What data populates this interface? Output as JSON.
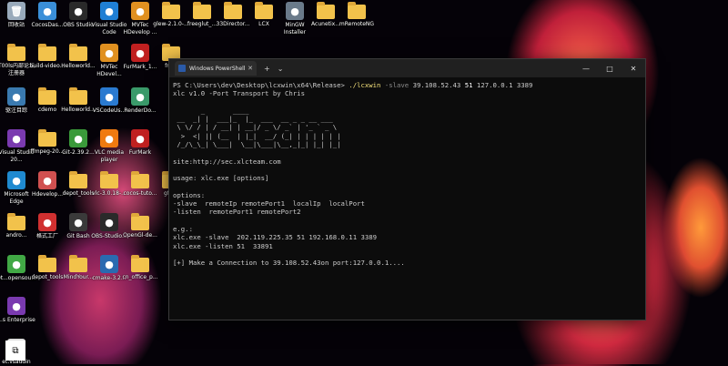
{
  "desktop": {
    "icons": [
      {
        "label": "回收站",
        "type": "recycle",
        "color": "#9ab"
      },
      {
        "label": "CocosDas...",
        "type": "app",
        "color": "#3a8fd8"
      },
      {
        "label": "OBS Studio",
        "type": "app",
        "color": "#2a2a2a"
      },
      {
        "label": "Visual Studio Code",
        "type": "app",
        "color": "#1f7fd4"
      },
      {
        "label": "MVTec HDevelop ...",
        "type": "app",
        "color": "#e09020"
      },
      {
        "label": "glew-2.1.0-...",
        "type": "folder"
      },
      {
        "label": "freeglut_...",
        "type": "folder"
      },
      {
        "label": "33Director...",
        "type": "folder"
      },
      {
        "label": "LCX",
        "type": "folder"
      },
      {
        "label": "MinGW Installer",
        "type": "app",
        "color": "#6a7a8a"
      },
      {
        "label": "Acunetix...",
        "type": "folder"
      },
      {
        "label": "mRemoteNG",
        "type": "folder"
      },
      {
        "label": "T00ls内部论坛注册器",
        "type": "folder"
      },
      {
        "label": "build-video...",
        "type": "folder"
      },
      {
        "label": "Helloworld...",
        "type": "folder"
      },
      {
        "label": "MVTec HDevel...",
        "type": "app",
        "color": "#e09020"
      },
      {
        "label": "FurMark_1...",
        "type": "app",
        "color": "#c02020"
      },
      {
        "label": "fre...",
        "type": "folder"
      },
      {
        "label": "驱注目踪",
        "type": "app",
        "color": "#3a7ab0"
      },
      {
        "label": "cdemo",
        "type": "folder"
      },
      {
        "label": "Helloworld...",
        "type": "folder"
      },
      {
        "label": "VSCodeUs...",
        "type": "app",
        "color": "#2a7ad0"
      },
      {
        "label": "RenderDo...",
        "type": "app",
        "color": "#3a9a6a"
      },
      {
        "label": "Visual Studio 20...",
        "type": "app",
        "color": "#7a3ab0"
      },
      {
        "label": "ffmpeg-20...",
        "type": "folder"
      },
      {
        "label": "Git-2.39.2...",
        "type": "app",
        "color": "#3a9a3a"
      },
      {
        "label": "VLC media player",
        "type": "app",
        "color": "#f07a10"
      },
      {
        "label": "FurMark",
        "type": "app",
        "color": "#c02020"
      },
      {
        "label": "Microsoft Edge",
        "type": "app",
        "color": "#1f8ad0"
      },
      {
        "label": "Hdevelop...",
        "type": "app",
        "color": "#d05050"
      },
      {
        "label": "depot_tools",
        "type": "folder"
      },
      {
        "label": "vlc-3.0.18-...",
        "type": "folder"
      },
      {
        "label": "cocos-tuto...",
        "type": "folder"
      },
      {
        "label": "gfw...",
        "type": "folder"
      },
      {
        "label": "andro...",
        "type": "folder"
      },
      {
        "label": "格式工厂",
        "type": "app",
        "color": "#d03030"
      },
      {
        "label": "Git Bash",
        "type": "app",
        "color": "#3a3a3a"
      },
      {
        "label": "OBS-Studio...",
        "type": "app",
        "color": "#2a2a2a"
      },
      {
        "label": "OpenGl-de...",
        "type": "folder"
      },
      {
        "label": "Qt...opensou...",
        "type": "app",
        "color": "#41a845"
      },
      {
        "label": "depot_tools",
        "type": "folder"
      },
      {
        "label": "MindYour...",
        "type": "folder"
      },
      {
        "label": "cmake-3.2...",
        "type": "app",
        "color": "#2a6ab0"
      },
      {
        "label": "cn_office_p...",
        "type": "folder"
      },
      {
        "label": "...s Enterprise",
        "type": "app",
        "color": "#7a3ab0"
      },
      {
        "label": "et.vsaddin",
        "type": "file"
      }
    ]
  },
  "terminal": {
    "window_title": "Windows PowerShell",
    "new_tab_glyph": "+",
    "dropdown_glyph": "⌄",
    "minimize_glyph": "—",
    "maximize_glyph": "□",
    "close_glyph": "✕",
    "prompt": "PS C:\\Users\\dev\\Desktop\\lcxwin\\x64\\Release> ",
    "command": "./lcxwin",
    "arg_flag": " -slave",
    "arg_ip": " 39.108.52.43 ",
    "arg_port": "51",
    "arg_rest": " 127.0.0.1 3389",
    "lines": [
      "xlc v1.0 -Port Transport by Chris",
      "",
      "       _       ____",
      " __  _| |  ___|_  |_  ___  __ _ _ __ ___",
      " \\ \\/ / | / __| | __|/ _ \\/ _` | '_ ` _ \\",
      "  >  <| || (__  | |_|  __/ (_| | | | | | |",
      " /_/\\_\\_| \\___|  \\__|\\___|\\__,_|_| |_| |_|",
      "",
      "site:http://sec.xlcteam.com",
      "",
      "usage: xlc.exe [options]",
      "",
      "options:",
      "-slave  remoteIp remotePort1  localIp  localPort",
      "-listen  remotePort1 remotePort2",
      "",
      "e.g.:",
      "xlc.exe -slave  202.119.225.35 51 192.168.0.11 3389",
      "xlc.exe -listen 51  33891",
      "",
      "[+] Make a Connection to 39.108.52.43on port:127.0.0.1...."
    ]
  }
}
